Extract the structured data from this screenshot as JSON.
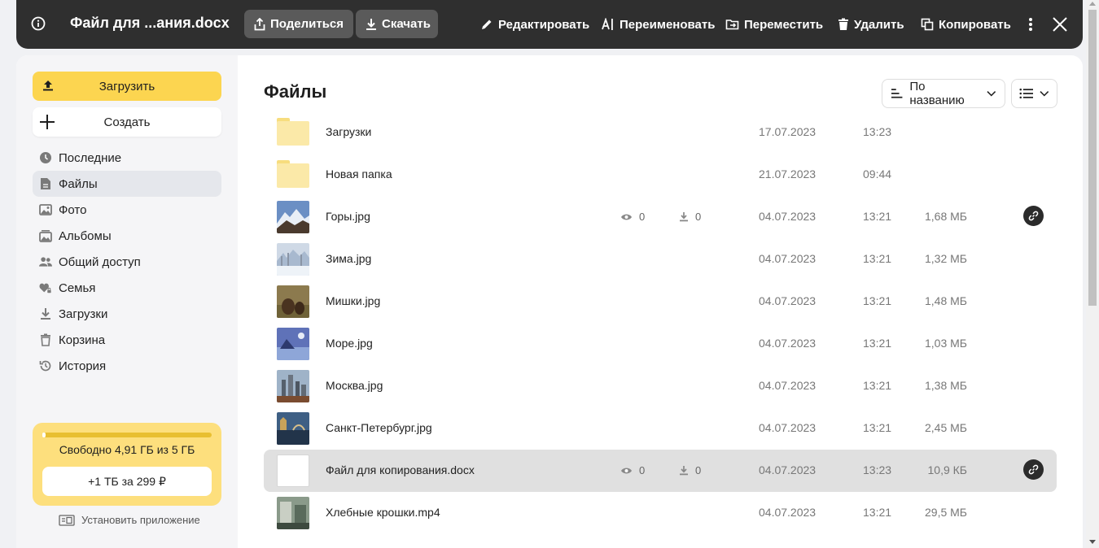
{
  "topbar": {
    "title": "Файл для ...ания.docx",
    "share_label": "Поделиться",
    "download_label": "Скачать",
    "edit_label": "Редактировать",
    "rename_label": "Переименовать",
    "move_label": "Переместить",
    "delete_label": "Удалить",
    "copy_label": "Копировать"
  },
  "sidebar": {
    "upload_label": "Загрузить",
    "create_label": "Создать",
    "items": [
      {
        "label": "Последние",
        "icon": "clock-icon"
      },
      {
        "label": "Файлы",
        "icon": "file-icon",
        "active": true
      },
      {
        "label": "Фото",
        "icon": "photo-icon"
      },
      {
        "label": "Альбомы",
        "icon": "albums-icon"
      },
      {
        "label": "Общий доступ",
        "icon": "shared-icon"
      },
      {
        "label": "Семья",
        "icon": "family-icon"
      },
      {
        "label": "Загрузки",
        "icon": "download-icon"
      },
      {
        "label": "Корзина",
        "icon": "trash-icon"
      },
      {
        "label": "История",
        "icon": "history-icon"
      }
    ],
    "storage": {
      "free_text": "Свободно 4,91 ГБ из 5 ГБ",
      "used_fraction": 0.02,
      "plan_label": "+1 ТБ за 299 ₽"
    },
    "install_label": "Установить приложение"
  },
  "main": {
    "title": "Файлы",
    "sort_label": "По названию",
    "files": [
      {
        "name": "Загрузки",
        "type": "folder",
        "date": "17.07.2023",
        "time": "13:23",
        "size": ""
      },
      {
        "name": "Новая папка",
        "type": "folder",
        "date": "21.07.2023",
        "time": "09:44",
        "size": ""
      },
      {
        "name": "Горы.jpg",
        "type": "image",
        "thumb": "mountains",
        "views": "0",
        "downloads": "0",
        "date": "04.07.2023",
        "time": "13:21",
        "size": "1,68 МБ",
        "shared": true
      },
      {
        "name": "Зима.jpg",
        "type": "image",
        "thumb": "winter",
        "date": "04.07.2023",
        "time": "13:21",
        "size": "1,32 МБ"
      },
      {
        "name": "Мишки.jpg",
        "type": "image",
        "thumb": "bears",
        "date": "04.07.2023",
        "time": "13:21",
        "size": "1,48 МБ"
      },
      {
        "name": "Море.jpg",
        "type": "image",
        "thumb": "sea",
        "date": "04.07.2023",
        "time": "13:21",
        "size": "1,03 МБ"
      },
      {
        "name": "Москва.jpg",
        "type": "image",
        "thumb": "moscow",
        "date": "04.07.2023",
        "time": "13:21",
        "size": "1,38 МБ"
      },
      {
        "name": "Санкт-Петербург.jpg",
        "type": "image",
        "thumb": "spb",
        "date": "04.07.2023",
        "time": "13:21",
        "size": "2,45 МБ"
      },
      {
        "name": "Файл для копирования.docx",
        "type": "doc",
        "views": "0",
        "downloads": "0",
        "date": "04.07.2023",
        "time": "13:23",
        "size": "10,9 КБ",
        "shared": true,
        "selected": true
      },
      {
        "name": "Хлебные крошки.mp4",
        "type": "video",
        "thumb": "video",
        "date": "04.07.2023",
        "time": "13:21",
        "size": "29,5 МБ"
      }
    ]
  },
  "colors": {
    "accent_yellow": "#fcd550",
    "topbar_bg": "#2f2f2f",
    "selected_row": "#e0e0e0"
  }
}
